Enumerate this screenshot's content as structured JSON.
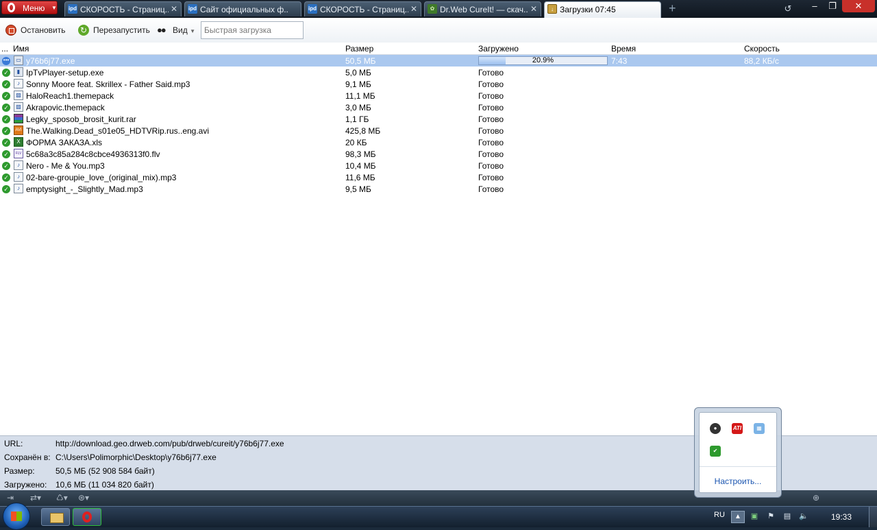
{
  "menu": {
    "label": "Меню"
  },
  "tabs": [
    {
      "title": "СКОРОСТЬ - Страниц...",
      "icon": "ipd"
    },
    {
      "title": "Сайт официальных ф...",
      "icon": "ipd"
    },
    {
      "title": "СКОРОСТЬ - Страниц...",
      "icon": "ipd"
    },
    {
      "title": "Dr.Web CureIt! — скач...",
      "icon": "drweb"
    },
    {
      "title": "Загрузки 07:45",
      "icon": "download"
    }
  ],
  "toolbar": {
    "stop_label": "Остановить",
    "restart_label": "Перезапустить",
    "view_label": "Вид",
    "quick_placeholder": "Быстрая загрузка"
  },
  "columns": {
    "dots": "...",
    "name": "Имя",
    "size": "Размер",
    "loaded": "Загружено",
    "time": "Время",
    "speed": "Скорость"
  },
  "active_download": {
    "name": "y76b6j77.exe",
    "size": "50,5 МБ",
    "progress": 20.9,
    "progress_label": "20.9%",
    "time": "7:43",
    "speed": "88,2 КБ/с"
  },
  "downloads": [
    {
      "name": "IpTvPlayer-setup.exe",
      "size": "5,0 МБ",
      "status": "Готово",
      "type": "exe"
    },
    {
      "name": "Sonny Moore feat. Skrillex - Father Said.mp3",
      "size": "9,1 МБ",
      "status": "Готово",
      "type": "mp3"
    },
    {
      "name": "HaloReach1.themepack",
      "size": "11,1 МБ",
      "status": "Готово",
      "type": "theme"
    },
    {
      "name": "Akrapovic.themepack",
      "size": "3,0 МБ",
      "status": "Готово",
      "type": "theme"
    },
    {
      "name": "Legky_sposob_brosit_kurit.rar",
      "size": "1,1 ГБ",
      "status": "Готово",
      "type": "rar"
    },
    {
      "name": "The.Walking.Dead_s01e05_HDTVRip.rus..eng.avi",
      "size": "425,8 МБ",
      "status": "Готово",
      "type": "avi"
    },
    {
      "name": "ФОРМА ЗАКАЗА.xls",
      "size": "20 КБ",
      "status": "Готово",
      "type": "xls"
    },
    {
      "name": "5c68a3c85a284c8cbce4936313f0.flv",
      "size": "98,3 МБ",
      "status": "Готово",
      "type": "flv"
    },
    {
      "name": "Nero - Me & You.mp3",
      "size": "10,4 МБ",
      "status": "Готово",
      "type": "mp3"
    },
    {
      "name": "02-bare-groupie_love_(original_mix).mp3",
      "size": "11,6 МБ",
      "status": "Готово",
      "type": "mp3"
    },
    {
      "name": "emptysight_-_Slightly_Mad.mp3",
      "size": "9,5 МБ",
      "status": "Готово",
      "type": "mp3"
    }
  ],
  "details": {
    "url_label": "URL:",
    "url_value": "http://download.geo.drweb.com/pub/drweb/cureit/y76b6j77.exe",
    "saved_label": "Сохранён в:",
    "saved_value": "C:\\Users\\Polimorphic\\Desktop\\y76b6j77.exe",
    "size_label": "Размер:",
    "size_value": "50,5 МБ (52 908 584 байт)",
    "loaded_label": "Загружено:",
    "loaded_value": "10,6 МБ (11 034 820 байт)"
  },
  "tray_popup": {
    "icons": [
      "steam-icon",
      "ati-icon",
      "network-monitor-icon",
      "updater-icon"
    ],
    "customize_label": "Настроить..."
  },
  "taskbar": {
    "language": "RU",
    "clock": "19:33"
  },
  "colors": {
    "selection": "#aac8ef",
    "done_check": "#2e9a2e",
    "opera_red": "#d01818",
    "details_bg": "#d6deea"
  }
}
